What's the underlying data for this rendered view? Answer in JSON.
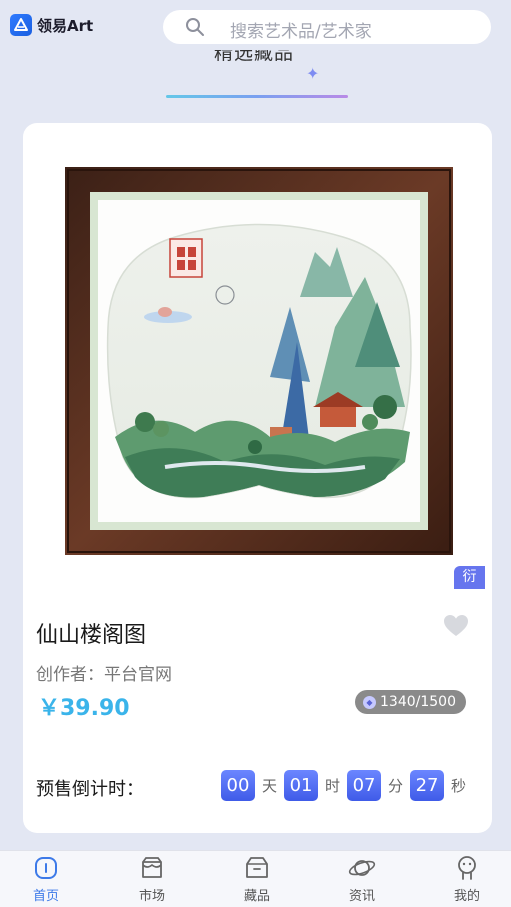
{
  "header": {
    "logo_text": "领易Art",
    "search_placeholder": "搜索艺术品/艺术家"
  },
  "section": {
    "title": "精选藏品"
  },
  "artwork": {
    "badge": "衍",
    "title": "仙山楼阁图",
    "creator": "创作者：平台官网",
    "price": "￥39.90",
    "stock": "1340/1500",
    "countdown_label": "预售倒计时：",
    "countdown": {
      "days": "00",
      "days_unit": "天",
      "hours": "01",
      "hours_unit": "时",
      "minutes": "07",
      "minutes_unit": "分",
      "seconds": "27",
      "seconds_unit": "秒"
    }
  },
  "bottom_nav": {
    "items": [
      {
        "label": "首页",
        "icon": "home-icon",
        "active": true
      },
      {
        "label": "市场",
        "icon": "store-icon",
        "active": false
      },
      {
        "label": "藏品",
        "icon": "box-icon",
        "active": false
      },
      {
        "label": "资讯",
        "icon": "planet-icon",
        "active": false
      },
      {
        "label": "我的",
        "icon": "profile-icon",
        "active": false
      }
    ]
  },
  "colors": {
    "accent": "#3d7ae8",
    "price": "#3ab4ea",
    "countdown_box": "#4f6cf0",
    "badge": "#6675ee",
    "background": "#e3e7f3"
  }
}
